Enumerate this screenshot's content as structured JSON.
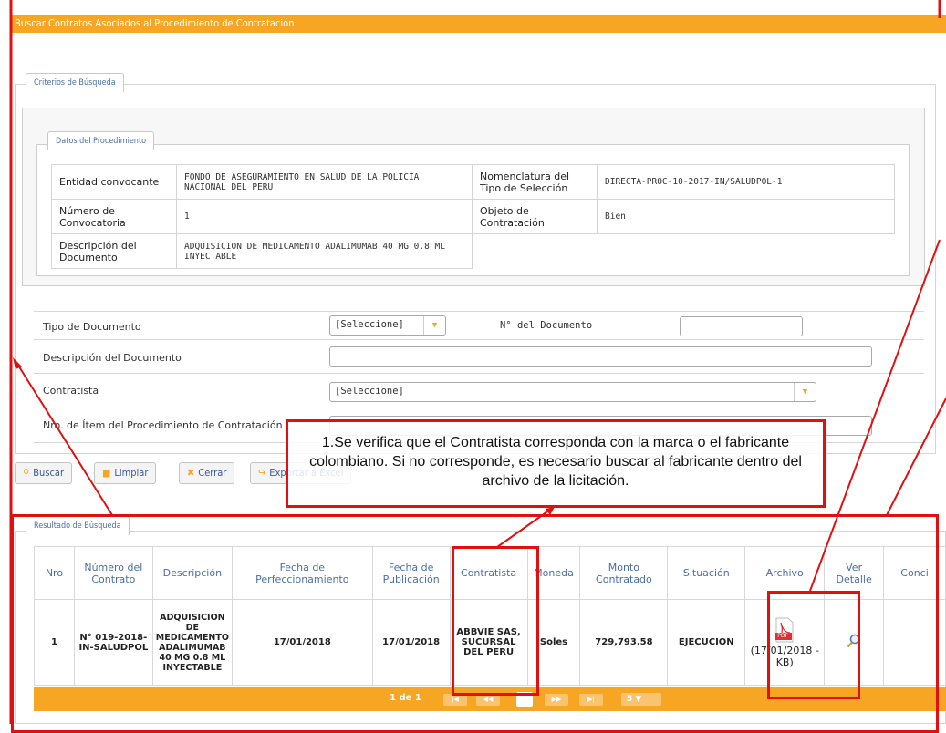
{
  "window": {
    "title": "Buscar Contratos Asociados al Procedimiento de Contratación"
  },
  "sections": {
    "criterios": "Criterios de Búsqueda",
    "datos_procedimiento": "Datos del Procedimiento",
    "resultado": "Resultado de Búsqueda"
  },
  "procedimiento": {
    "entidad_label": "Entidad convocante",
    "entidad_value": "FONDO DE ASEGURAMIENTO EN SALUD DE LA POLICIA NACIONAL DEL PERU",
    "nomenclatura_label": "Nomenclatura del Tipo de Selección",
    "nomenclatura_value": "DIRECTA-PROC-10-2017-IN/SALUDPOL-1",
    "numero_label": "Número de Convocatoria",
    "numero_value": "1",
    "objeto_label": "Objeto de Contratación",
    "objeto_value": "Bien",
    "descripcion_label": "Descripción del Documento",
    "descripcion_value": "ADQUISICION DE MEDICAMENTO ADALIMUMAB 40 MG 0.8 ML INYECTABLE"
  },
  "form": {
    "tipo_doc_label": "Tipo de Documento",
    "tipo_doc_value": "[Seleccione]",
    "num_doc_label": "N° del Documento",
    "num_doc_value": "",
    "desc_doc_label": "Descripción del Documento",
    "desc_doc_value": "",
    "contratista_label": "Contratista",
    "contratista_value": "[Seleccione]",
    "item_label": "Nro. de Ítem del Procedimiento de Contratación",
    "item_value": ""
  },
  "buttons": {
    "buscar": "Buscar",
    "limpiar": "Limpiar",
    "cerrar": "Cerrar",
    "exportar": "Exportar a Excel"
  },
  "results": {
    "headers": {
      "nro": "Nro",
      "numero": "Número del Contrato",
      "descripcion": "Descripción",
      "fecha_perf": "Fecha de Perfeccionamiento",
      "fecha_pub": "Fecha de Publicación",
      "contratista": "Contratista",
      "moneda": "Moneda",
      "monto": "Monto Contratado",
      "situacion": "Situación",
      "archivo": "Archivo",
      "ver": "Ver Detalle",
      "conci": "Conci"
    },
    "row": {
      "nro": "1",
      "numero": "N° 019-2018-IN-SALUDPOL",
      "descripcion": "ADQUISICION DE MEDICAMENTO ADALIMUMAB 40 MG 0.8 ML INYECTABLE",
      "fecha_perf": "17/01/2018",
      "fecha_pub": "17/01/2018",
      "contratista": "ABBVIE SAS, SUCURSAL DEL PERU",
      "moneda": "Soles",
      "monto": "729,793.58",
      "situacion": "EJECUCION",
      "archivo_badge": "PDF",
      "archivo_text": "(17/01/2018 - KB)"
    }
  },
  "pager": {
    "text": "1 de 1",
    "page_size": "5"
  },
  "annotation": {
    "text": "1.Se verifica que el Contratista corresponda con la marca o el fabricante colombiano. Si no corresponde, es necesario buscar al fabricante dentro del archivo de la licitación.",
    "color": "#e01010"
  },
  "colors": {
    "accent": "#f6a623",
    "link": "#4a6fa5"
  },
  "icons": [
    "search-icon",
    "trash-icon",
    "close-icon",
    "export-icon",
    "pdf-icon",
    "magnifier-icon",
    "chevron-down-icon"
  ]
}
